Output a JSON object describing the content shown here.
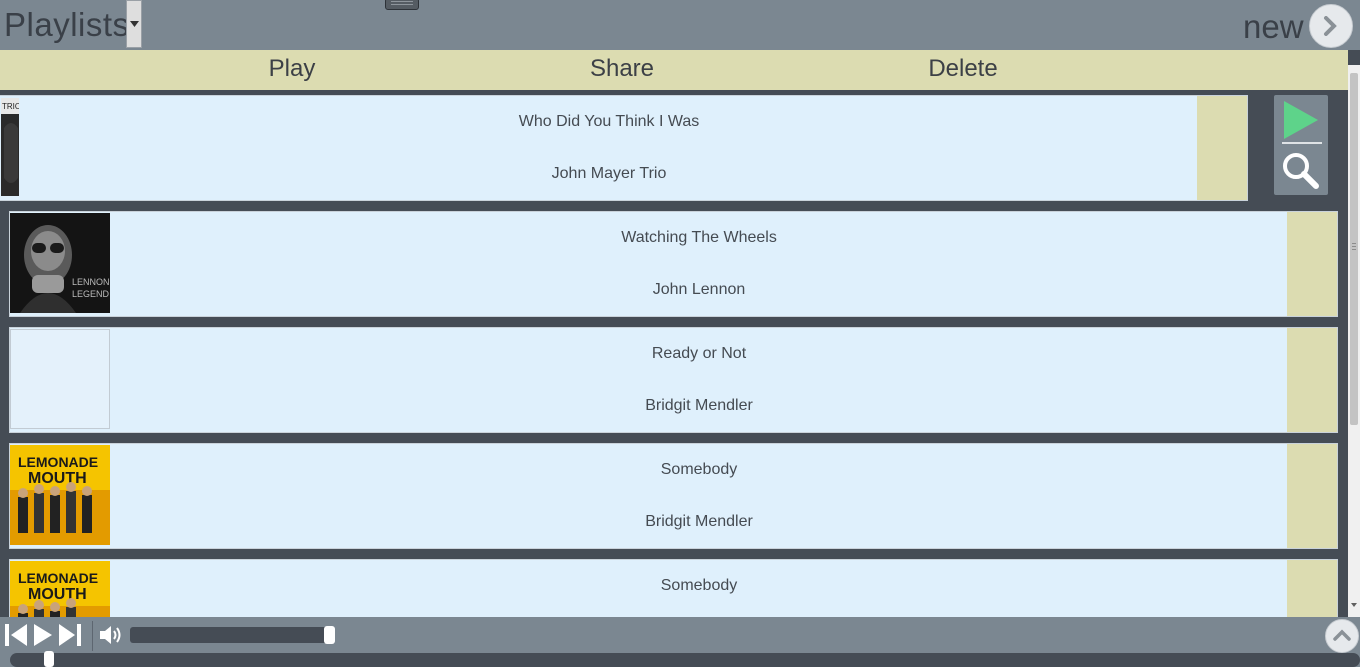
{
  "header": {
    "title": "Playlists",
    "new_label": "new"
  },
  "actions": {
    "play": "Play",
    "share": "Share",
    "delete": "Delete"
  },
  "tracks": [
    {
      "title": "Who Did You Think I Was",
      "artist": "John Mayer Trio",
      "cover": "trio"
    },
    {
      "title": "Watching The Wheels",
      "artist": "John Lennon",
      "cover": "lennon"
    },
    {
      "title": "Ready or Not",
      "artist": "Bridgit Mendler",
      "cover": "blank"
    },
    {
      "title": "Somebody",
      "artist": "Bridgit Mendler",
      "cover": "lemonade"
    },
    {
      "title": "Somebody",
      "artist": "",
      "cover": "lemonade"
    }
  ],
  "colors": {
    "header_bg": "#7b8791",
    "action_bar_bg": "#dcdcb1",
    "row_bg": "#dff0fc",
    "list_bg": "#454c55",
    "play_accent": "#5ed38a"
  },
  "player": {
    "volume_level": 0.97,
    "progress": 0.03
  },
  "icons": {
    "dropdown": "chevron-down-icon",
    "next": "chevron-right-icon",
    "row_play": "play-icon",
    "row_search": "search-icon",
    "prev": "skip-back-icon",
    "play": "play-icon",
    "skip": "skip-forward-icon",
    "volume": "volume-icon",
    "up": "chevron-up-icon"
  }
}
